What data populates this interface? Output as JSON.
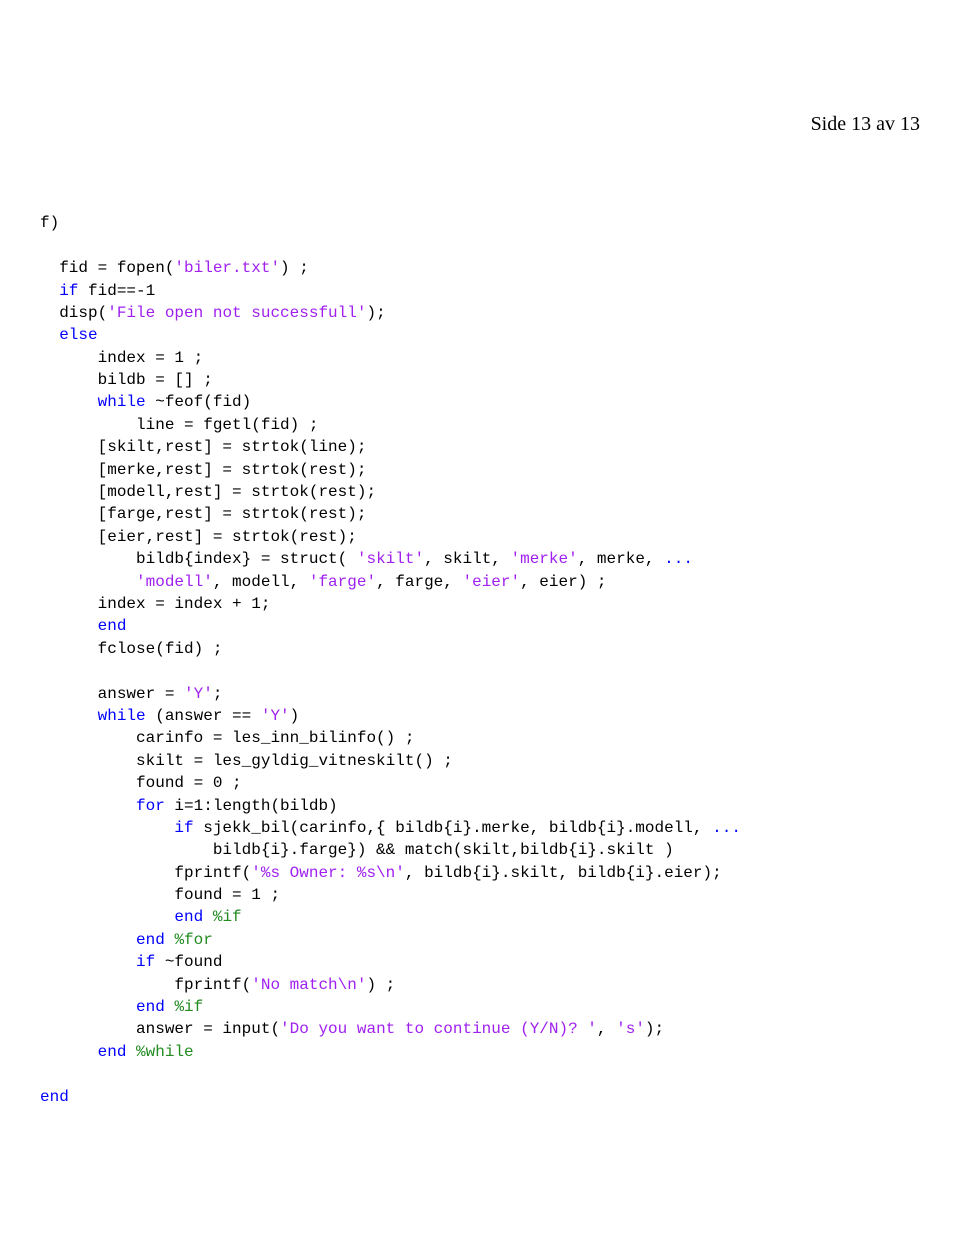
{
  "header": {
    "page_label": "Side 13 av 13"
  },
  "code": {
    "lines": [
      {
        "indent": 0,
        "segments": [
          {
            "text": "f)",
            "cls": ""
          }
        ]
      },
      {
        "indent": 0,
        "segments": []
      },
      {
        "indent": 1,
        "segments": [
          {
            "text": "fid = fopen(",
            "cls": ""
          },
          {
            "text": "'biler.txt'",
            "cls": "str"
          },
          {
            "text": ") ;",
            "cls": ""
          }
        ]
      },
      {
        "indent": 1,
        "segments": [
          {
            "text": "if",
            "cls": "kw"
          },
          {
            "text": " fid==-1",
            "cls": ""
          }
        ]
      },
      {
        "indent": 1,
        "segments": [
          {
            "text": "disp(",
            "cls": ""
          },
          {
            "text": "'File open not successfull'",
            "cls": "str"
          },
          {
            "text": ");",
            "cls": ""
          }
        ]
      },
      {
        "indent": 1,
        "segments": [
          {
            "text": "else",
            "cls": "kw"
          }
        ]
      },
      {
        "indent": 3,
        "segments": [
          {
            "text": "index = 1 ;",
            "cls": ""
          }
        ]
      },
      {
        "indent": 3,
        "segments": [
          {
            "text": "bildb = [] ;",
            "cls": ""
          }
        ]
      },
      {
        "indent": 3,
        "segments": [
          {
            "text": "while",
            "cls": "kw"
          },
          {
            "text": " ~feof(fid)",
            "cls": ""
          }
        ]
      },
      {
        "indent": 5,
        "segments": [
          {
            "text": "line = fgetl(fid) ;",
            "cls": ""
          }
        ]
      },
      {
        "indent": 3,
        "segments": [
          {
            "text": "[skilt,rest] = strtok(line);",
            "cls": ""
          }
        ]
      },
      {
        "indent": 3,
        "segments": [
          {
            "text": "[merke,rest] = strtok(rest);",
            "cls": ""
          }
        ]
      },
      {
        "indent": 3,
        "segments": [
          {
            "text": "[modell,rest] = strtok(rest);",
            "cls": ""
          }
        ]
      },
      {
        "indent": 3,
        "segments": [
          {
            "text": "[farge,rest] = strtok(rest);",
            "cls": ""
          }
        ]
      },
      {
        "indent": 3,
        "segments": [
          {
            "text": "[eier,rest] = strtok(rest);",
            "cls": ""
          }
        ]
      },
      {
        "indent": 5,
        "segments": [
          {
            "text": "bildb{index} = struct( ",
            "cls": ""
          },
          {
            "text": "'skilt'",
            "cls": "str"
          },
          {
            "text": ", skilt, ",
            "cls": ""
          },
          {
            "text": "'merke'",
            "cls": "str"
          },
          {
            "text": ", merke,",
            "cls": ""
          },
          {
            "text": " ...",
            "cls": "cont"
          }
        ]
      },
      {
        "indent": 5,
        "segments": [
          {
            "text": "'modell'",
            "cls": "str"
          },
          {
            "text": ", modell, ",
            "cls": ""
          },
          {
            "text": "'farge'",
            "cls": "str"
          },
          {
            "text": ", farge, ",
            "cls": ""
          },
          {
            "text": "'eier'",
            "cls": "str"
          },
          {
            "text": ", eier) ;",
            "cls": ""
          }
        ]
      },
      {
        "indent": 3,
        "segments": [
          {
            "text": "index = index + 1;",
            "cls": ""
          }
        ]
      },
      {
        "indent": 3,
        "segments": [
          {
            "text": "end",
            "cls": "kw"
          }
        ]
      },
      {
        "indent": 3,
        "segments": [
          {
            "text": "fclose(fid) ;",
            "cls": ""
          }
        ]
      },
      {
        "indent": 0,
        "segments": []
      },
      {
        "indent": 3,
        "segments": [
          {
            "text": "answer = ",
            "cls": ""
          },
          {
            "text": "'Y'",
            "cls": "str"
          },
          {
            "text": ";",
            "cls": ""
          }
        ]
      },
      {
        "indent": 3,
        "segments": [
          {
            "text": "while",
            "cls": "kw"
          },
          {
            "text": " (answer == ",
            "cls": ""
          },
          {
            "text": "'Y'",
            "cls": "str"
          },
          {
            "text": ")",
            "cls": ""
          }
        ]
      },
      {
        "indent": 5,
        "segments": [
          {
            "text": "carinfo = les_inn_bilinfo() ;",
            "cls": ""
          }
        ]
      },
      {
        "indent": 5,
        "segments": [
          {
            "text": "skilt = les_gyldig_vitneskilt() ;",
            "cls": ""
          }
        ]
      },
      {
        "indent": 5,
        "segments": [
          {
            "text": "found = 0 ;",
            "cls": ""
          }
        ]
      },
      {
        "indent": 5,
        "segments": [
          {
            "text": "for",
            "cls": "kw"
          },
          {
            "text": " i=1:length(bildb)",
            "cls": ""
          }
        ]
      },
      {
        "indent": 7,
        "segments": [
          {
            "text": "if",
            "cls": "kw"
          },
          {
            "text": " sjekk_bil(carinfo,{ bildb{i}.merke, bildb{i}.modell,",
            "cls": ""
          },
          {
            "text": " ...",
            "cls": "cont"
          }
        ]
      },
      {
        "indent": 9,
        "segments": [
          {
            "text": "bildb{i}.farge}) && match(skilt,bildb{i}.skilt )",
            "cls": ""
          }
        ]
      },
      {
        "indent": 7,
        "segments": [
          {
            "text": "fprintf(",
            "cls": ""
          },
          {
            "text": "'%s Owner: %s\\n'",
            "cls": "str"
          },
          {
            "text": ", bildb{i}.skilt, bildb{i}.eier);",
            "cls": ""
          }
        ]
      },
      {
        "indent": 7,
        "segments": [
          {
            "text": "found = 1 ;",
            "cls": ""
          }
        ]
      },
      {
        "indent": 7,
        "segments": [
          {
            "text": "end",
            "cls": "kw"
          },
          {
            "text": " ",
            "cls": ""
          },
          {
            "text": "%if",
            "cls": "com"
          }
        ]
      },
      {
        "indent": 5,
        "segments": [
          {
            "text": "end",
            "cls": "kw"
          },
          {
            "text": " ",
            "cls": ""
          },
          {
            "text": "%for",
            "cls": "com"
          }
        ]
      },
      {
        "indent": 5,
        "segments": [
          {
            "text": "if",
            "cls": "kw"
          },
          {
            "text": " ~found",
            "cls": ""
          }
        ]
      },
      {
        "indent": 7,
        "segments": [
          {
            "text": "fprintf(",
            "cls": ""
          },
          {
            "text": "'No match\\n'",
            "cls": "str"
          },
          {
            "text": ") ;",
            "cls": ""
          }
        ]
      },
      {
        "indent": 5,
        "segments": [
          {
            "text": "end",
            "cls": "kw"
          },
          {
            "text": " ",
            "cls": ""
          },
          {
            "text": "%if",
            "cls": "com"
          }
        ]
      },
      {
        "indent": 5,
        "segments": [
          {
            "text": "answer = input(",
            "cls": ""
          },
          {
            "text": "'Do you want to continue (Y/N)? '",
            "cls": "str"
          },
          {
            "text": ", ",
            "cls": ""
          },
          {
            "text": "'s'",
            "cls": "str"
          },
          {
            "text": ");",
            "cls": ""
          }
        ]
      },
      {
        "indent": 3,
        "segments": [
          {
            "text": "end",
            "cls": "kw"
          },
          {
            "text": " ",
            "cls": ""
          },
          {
            "text": "%while",
            "cls": "com"
          }
        ]
      },
      {
        "indent": 0,
        "segments": []
      },
      {
        "indent": 0,
        "segments": [
          {
            "text": "end",
            "cls": "kw"
          }
        ]
      }
    ]
  }
}
